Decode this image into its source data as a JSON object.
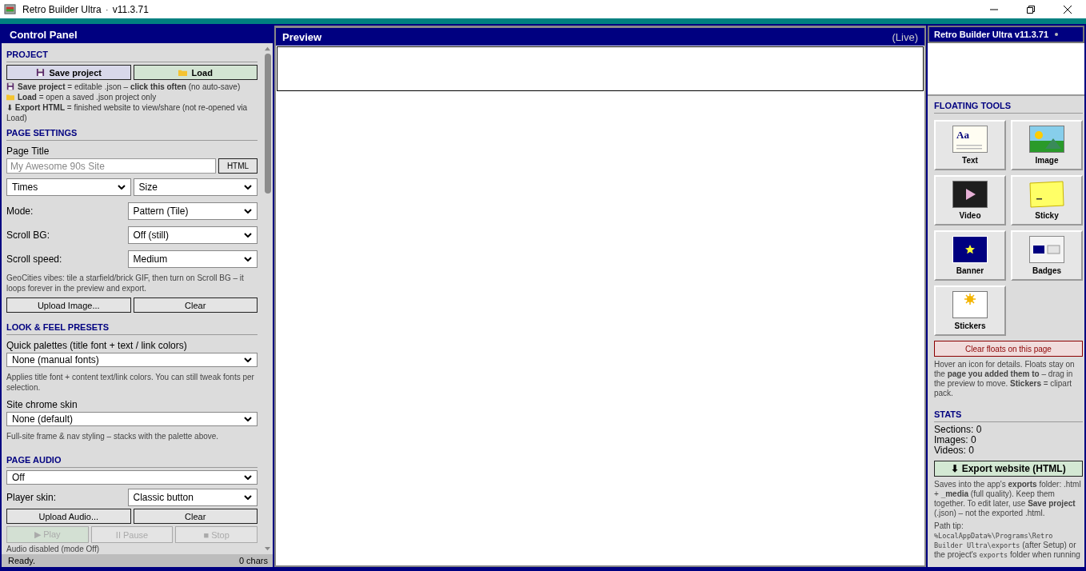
{
  "window": {
    "title": "Retro Builder Ultra",
    "separator": "·",
    "version": "v11.3.71"
  },
  "control_panel": {
    "title": "Control Panel",
    "project": {
      "heading": "PROJECT",
      "save": "Save project",
      "load": "Load",
      "notes": [
        {
          "kind": "floppy",
          "text": "**Save project** = editable .json – **click this often** (no auto-save)"
        },
        {
          "kind": "folder",
          "text": "**Load** = open a saved .json project only"
        },
        {
          "kind": "plain",
          "text": "⬇ **Export HTML** = finished website to view/share (not re-opened via Load)"
        }
      ]
    },
    "page_settings": {
      "heading": "PAGE SETTINGS",
      "title_label": "Page Title",
      "title_placeholder": "My Awesome 90s Site",
      "html_button": "HTML",
      "font": "Times",
      "size": "Size",
      "rows": [
        {
          "label": "Mode:",
          "value": "Pattern (Tile)"
        },
        {
          "label": "Scroll BG:",
          "value": "Off (still)"
        },
        {
          "label": "Scroll speed:",
          "value": "Medium"
        }
      ],
      "note": "GeoCities vibes: tile a starfield/brick GIF, then turn on Scroll BG – it loops forever in the preview and export.",
      "upload": "Upload Image...",
      "clear": "Clear"
    },
    "look_feel": {
      "heading": "LOOK & FEEL PRESETS",
      "palette_label": "Quick palettes (title font + text / link colors)",
      "palette": "None (manual fonts)",
      "palette_note": "Applies title font + content text/link colors. You can still tweak fonts per selection.",
      "skin_label": "Site chrome skin",
      "skin": "None (default)",
      "skin_note": "Full-site frame & nav styling – stacks with the palette above."
    },
    "page_audio": {
      "heading": "PAGE AUDIO",
      "mode": "Off",
      "player_label": "Player skin:",
      "player": "Classic button",
      "upload": "Upload Audio...",
      "clear": "Clear",
      "transport": [
        {
          "kind": "play",
          "label": "▶ Play",
          "disabled": true
        },
        {
          "kind": "pause",
          "label": "II Pause",
          "disabled": true
        },
        {
          "kind": "stop",
          "label": "■ Stop",
          "disabled": true
        }
      ],
      "note": "Audio disabled (mode Off)"
    },
    "status": {
      "message": "Ready.",
      "count": "0 chars"
    }
  },
  "preview": {
    "title": "Preview",
    "mode": "(Live)"
  },
  "side": {
    "badge": "Retro Builder Ultra v11.3.71",
    "floating_tools": {
      "heading": "FLOATING TOOLS",
      "tools": [
        {
          "kind": "text",
          "label": "Text",
          "icon_text": "Aa"
        },
        {
          "kind": "image",
          "label": "Image"
        },
        {
          "kind": "video",
          "label": "Video"
        },
        {
          "kind": "sticky",
          "label": "Sticky"
        },
        {
          "kind": "banner",
          "label": "Banner"
        },
        {
          "kind": "badges",
          "label": "Badges"
        },
        {
          "kind": "stickers",
          "label": "Stickers"
        }
      ],
      "clear": "Clear floats on this page",
      "note": "Hover an icon for details. Floats stay on the **page you added them to** – drag in the preview to move. **Stickers** = clipart pack."
    },
    "stats": {
      "heading": "STATS",
      "lines": [
        "Sections: 0",
        "Images: 0",
        "Videos: 0"
      ]
    },
    "export": "⬇ Export website (HTML)",
    "export_note": "Saves into the app's **exports** folder: .html + **_media** (full quality). Keep them together. To edit later, use **Save project** (.json) – not the exported .html.",
    "path_label": "Path tip:",
    "path_tip": [
      {
        "kind": "code",
        "text": "%LocalAppData%\\Programs\\Retro Builder Ultra\\exports"
      },
      {
        "kind": "text",
        "text": " (after Setup) or the project's "
      },
      {
        "kind": "code",
        "text": "exports"
      },
      {
        "kind": "text",
        "text": " folder when running"
      }
    ]
  }
}
